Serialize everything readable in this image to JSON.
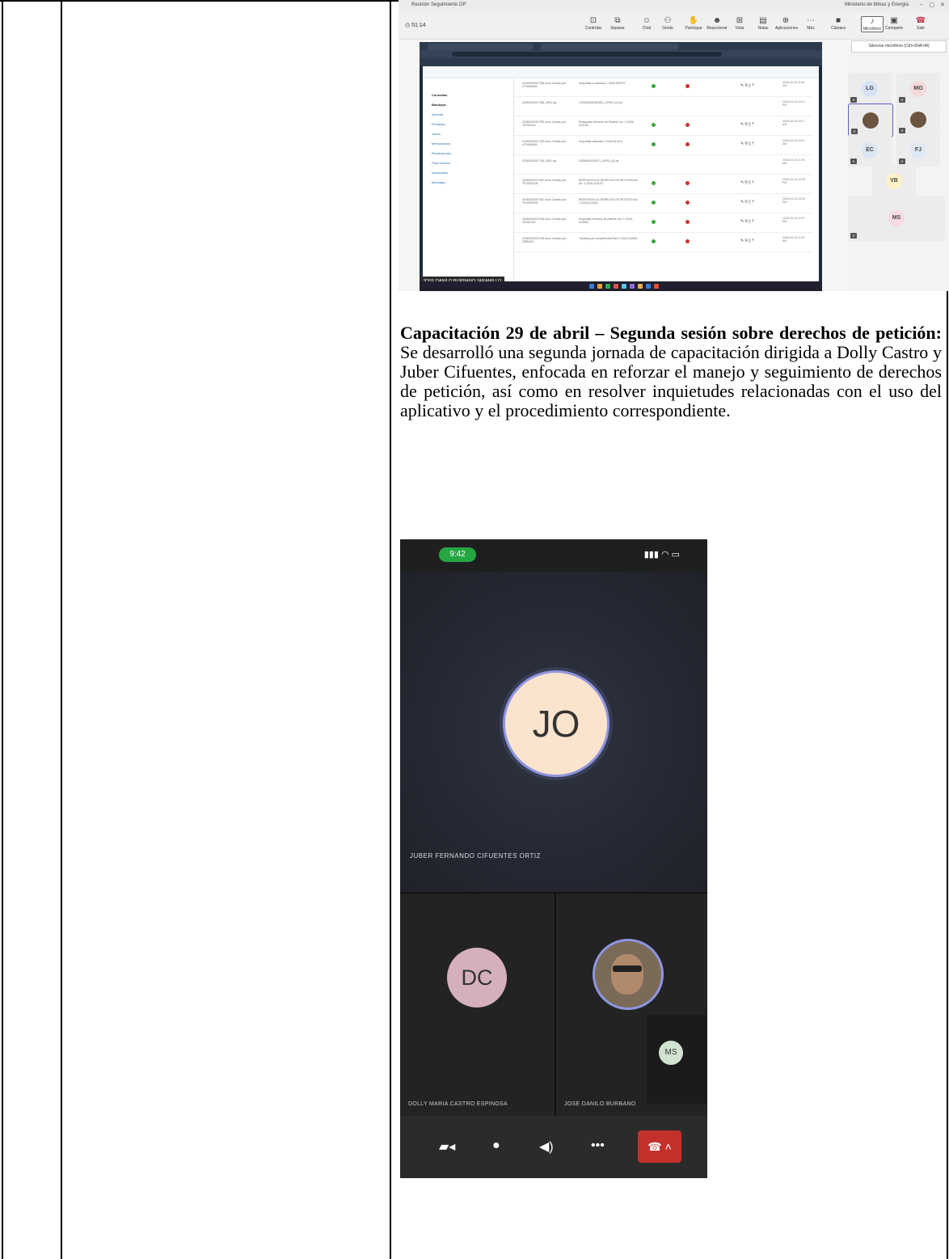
{
  "teams": {
    "window_title": "Reunión Seguimiento DP",
    "org_label": "Ministerio de Minas y Energía",
    "timer": "51:14",
    "toolbar": [
      {
        "label": "Controlar",
        "icon": "control-icon"
      },
      {
        "label": "Separar",
        "icon": "pop-out-icon"
      },
      {
        "label": "Chat",
        "icon": "chat-icon"
      },
      {
        "label": "Gente",
        "icon": "people-icon"
      },
      {
        "label": "Participar",
        "icon": "raise-hand-icon"
      },
      {
        "label": "Reaccionar",
        "icon": "react-icon"
      },
      {
        "label": "Vista",
        "icon": "view-icon"
      },
      {
        "label": "Notas",
        "icon": "notes-icon"
      },
      {
        "label": "Aplicaciones",
        "icon": "apps-icon"
      },
      {
        "label": "Más",
        "icon": "more-icon"
      },
      {
        "label": "Cámara",
        "icon": "camera-icon"
      },
      {
        "label": "Micrófono",
        "icon": "microphone-icon"
      },
      {
        "label": "Comparte",
        "icon": "share-icon"
      },
      {
        "label": "Salir",
        "icon": "leave-icon"
      }
    ],
    "tooltip": "Silenciar micrófono (Ctrl+Shift+M)",
    "presenter": "JOSE DANILO BURBANO JARAMILLO",
    "participants": [
      "LG",
      "MG",
      "",
      "",
      "EC",
      "FJ",
      "VB",
      "MS"
    ],
    "side_menu": [
      "Consultas",
      "Bandejas",
      "General",
      "Firmados",
      "Vistos",
      "Memorandos",
      "Resoluciones",
      "Para revisión",
      "Informados",
      "Mensajes"
    ],
    "rows": [
      {
        "doc": "20260200017786.docx Creado por: LPTAMARA",
        "desc": "respuesta a radicado 1-2026-008732",
        "date": "2026-04-20 11:30 AM"
      },
      {
        "doc": "20260200017786_0001.zip",
        "desc": "1202604200401501_20001 (1).zip",
        "date": "2026-04-20 12:13 PM"
      },
      {
        "doc": "20260200017780.docx Creado por: JCRUEDA",
        "desc": "Respuesta Derecho de Petición No. 1-2026-013758",
        "date": "2026-04-20 10:17 AM"
      },
      {
        "doc": "20260200017753.docx Creado por: LPTAMARA",
        "desc": "respuesta radicado 1-2026-013141",
        "date": "2026-04-20 10:11 AM"
      },
      {
        "doc": "20260200017753_0001.zip",
        "desc": "20260400319471_00001 (2).zip",
        "date": "2026-04-20 11:09 AM"
      },
      {
        "doc": "20260200017367.docx Creado por: YFGARZON",
        "desc": "RESPUESTA AL DERECHO DE PETICION No No. 1-2026-014037",
        "date": "2026-04-16 10:30 PM"
      },
      {
        "doc": "20260200017361.docx Creado por: YFGARZON",
        "desc": "RESPUESTA AL DERECHO DE PETICION No 1-2026-014262",
        "date": "2026-04-16 10:03 PM"
      },
      {
        "doc": "20260200017349.docx Creado por: JCRUEDA",
        "desc": "respuesta Derecho de petición No. 1-2026-013369",
        "date": "2026-04-16 12:07 PM"
      },
      {
        "doc": "20260200017299.docx Creado por: OBRAVO",
        "desc": "Traslado por competencia Rad 1-2026-014069",
        "date": "2026-04-15 11:03 AM"
      }
    ]
  },
  "paragraph": {
    "heading": "Capacitación 29 de abril – Segunda sesión sobre derechos de petición:",
    "body": "Se desarrolló una segunda jornada de capacitación dirigida a Dolly Castro y Juber Cifuentes, enfocada en reforzar el manejo y seguimiento de derechos de petición, así como en resolver inquietudes relacionadas con el uso del aplicativo y el procedimiento correspondiente."
  },
  "phone": {
    "time": "9:42",
    "main_initials": "JO",
    "main_name": "JUBER FERNANDO CIFUENTES ORTIZ",
    "left_initials": "DC",
    "left_name": "DOLLY MARIA CASTRO ESPINOSA",
    "right_name": "JOSE DANILO BURBANO",
    "mini_initials": "MS"
  },
  "colors": {
    "teams_accent": "#5b5fc7",
    "leave_red": "#c4312b",
    "status_green": "#26a641"
  }
}
